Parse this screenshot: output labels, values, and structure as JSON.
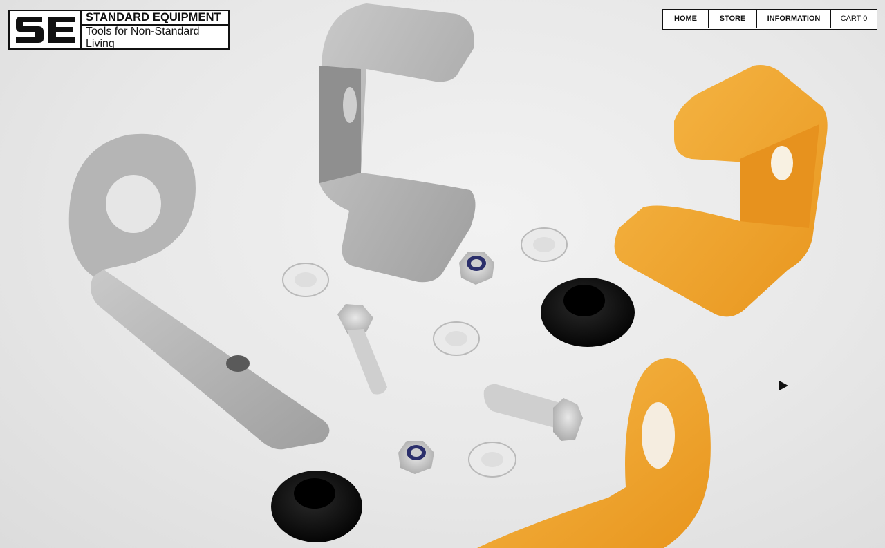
{
  "brand": {
    "mark": "SE",
    "title": "STANDARD EQUIPMENT",
    "tagline": "Tools for Non-Standard Living"
  },
  "nav": {
    "items": [
      {
        "label": "HOME"
      },
      {
        "label": "STORE"
      },
      {
        "label": "INFORMATION"
      },
      {
        "label": "CART 0"
      }
    ]
  },
  "hero": {
    "media_control": "play-icon",
    "colors": {
      "aluminum": "#b9b9b9",
      "orange": "#f2a632",
      "rubber": "#151515",
      "background": "#e9e9e9"
    }
  }
}
